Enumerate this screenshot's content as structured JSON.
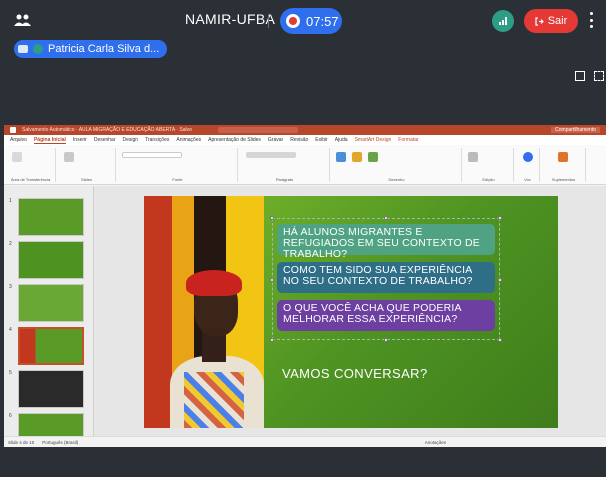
{
  "meeting": {
    "title": "NAMIR-UFBA",
    "recording_time": "07:57",
    "leave_label": "Sair",
    "presenter_name": "Patricia Carla Silva d..."
  },
  "ppt": {
    "window_title": "Salvamento Automático  ·  AULA MIGRAÇÃO E EDUCAÇÃO ABERTA  ·  Salvo",
    "search_placeholder": "Pesquisar",
    "share_label": "Compartilhamento",
    "tabs": [
      "Arquivo",
      "Página Inicial",
      "Inserir",
      "Desenhar",
      "Design",
      "Transições",
      "Animações",
      "Apresentação de Slides",
      "Gravar",
      "Revisão",
      "Exibir",
      "Ajuda",
      "SmartArt Design",
      "Formatar"
    ],
    "ribbon_groups": [
      "Área de Transferência",
      "Slides",
      "Fonte",
      "Parágrafo",
      "Desenho",
      "Edição",
      "Voz",
      "Suplementos"
    ],
    "status_left": "Slide 4 de 10",
    "status_lang": "Português (Brasil)",
    "status_right": "Anotações"
  },
  "slide": {
    "question1": "HÁ ALUNOS MIGRANTES E REFUGIADOS EM SEU CONTEXTO DE TRABALHO?",
    "question2": "COMO TEM SIDO SUA EXPERIÊNCIA NO SEU CONTEXTO DE TRABALHO?",
    "question3": "O QUE VOCÊ ACHA QUE PODERIA MELHORAR ESSA EXPERIÊNCIA?",
    "closing": "VAMOS CONVERSAR?"
  },
  "thumbnails": [
    {
      "number": "1"
    },
    {
      "number": "2"
    },
    {
      "number": "3"
    },
    {
      "number": "4"
    },
    {
      "number": "5"
    },
    {
      "number": "6"
    }
  ],
  "colors": {
    "accent_blue": "#2f6fed",
    "leave_red": "#e53935",
    "ppt_red": "#b7472a",
    "slide_green": "#5a9a26"
  }
}
